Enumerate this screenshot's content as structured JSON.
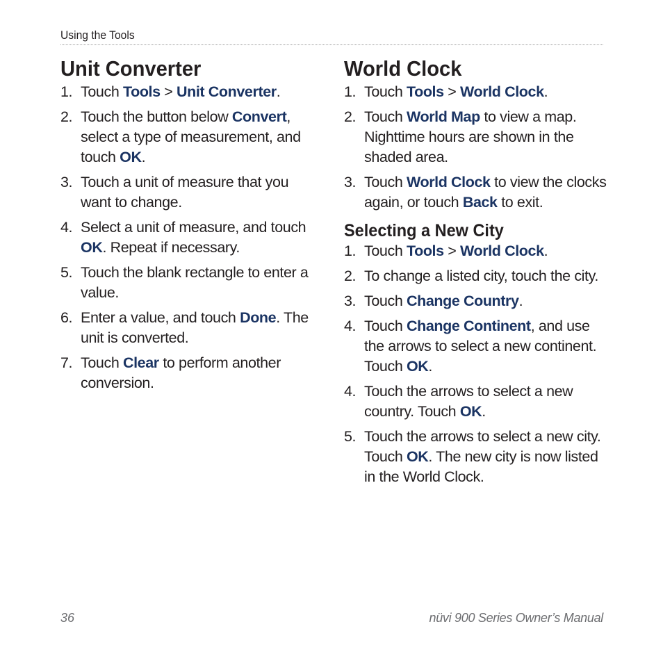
{
  "header": {
    "running_head": "Using the Tools"
  },
  "left": {
    "title": "Unit Converter",
    "steps": [
      {
        "num": "1.",
        "parts": [
          {
            "t": "Touch "
          },
          {
            "t": "Tools",
            "b": true
          },
          {
            "t": " > "
          },
          {
            "t": "Unit Converter",
            "b": true
          },
          {
            "t": "."
          }
        ]
      },
      {
        "num": "2.",
        "parts": [
          {
            "t": "Touch the button below "
          },
          {
            "t": "Convert",
            "b": true
          },
          {
            "t": ", select a type of measurement, and touch "
          },
          {
            "t": "OK",
            "b": true
          },
          {
            "t": "."
          }
        ]
      },
      {
        "num": "3.",
        "parts": [
          {
            "t": "Touch a unit of measure that you want to change."
          }
        ]
      },
      {
        "num": "4.",
        "parts": [
          {
            "t": "Select a unit of measure, and touch "
          },
          {
            "t": "OK",
            "b": true
          },
          {
            "t": ". Repeat if necessary."
          }
        ]
      },
      {
        "num": "5.",
        "parts": [
          {
            "t": "Touch the blank rectangle to enter a value."
          }
        ]
      },
      {
        "num": "6.",
        "parts": [
          {
            "t": "Enter a value, and touch "
          },
          {
            "t": "Done",
            "b": true
          },
          {
            "t": ". The unit is converted."
          }
        ]
      },
      {
        "num": "7.",
        "parts": [
          {
            "t": "Touch "
          },
          {
            "t": "Clear",
            "b": true
          },
          {
            "t": " to perform another conversion."
          }
        ]
      }
    ]
  },
  "right": {
    "title": "World Clock",
    "steps": [
      {
        "num": "1.",
        "parts": [
          {
            "t": "Touch "
          },
          {
            "t": "Tools",
            "b": true
          },
          {
            "t": " > "
          },
          {
            "t": "World Clock",
            "b": true
          },
          {
            "t": "."
          }
        ]
      },
      {
        "num": "2.",
        "parts": [
          {
            "t": "Touch "
          },
          {
            "t": "World Map",
            "b": true
          },
          {
            "t": " to view a map. Nighttime hours are shown in the shaded area."
          }
        ]
      },
      {
        "num": "3.",
        "parts": [
          {
            "t": "Touch "
          },
          {
            "t": "World Clock",
            "b": true
          },
          {
            "t": " to view the clocks again, or touch "
          },
          {
            "t": "Back",
            "b": true
          },
          {
            "t": " to exit."
          }
        ]
      }
    ],
    "subsection": {
      "title": "Selecting a New City",
      "steps": [
        {
          "num": "1.",
          "parts": [
            {
              "t": "Touch "
            },
            {
              "t": "Tools",
              "b": true
            },
            {
              "t": " > "
            },
            {
              "t": "World Clock",
              "b": true
            },
            {
              "t": "."
            }
          ]
        },
        {
          "num": "2.",
          "parts": [
            {
              "t": "To change a listed city, touch the city."
            }
          ]
        },
        {
          "num": "3.",
          "parts": [
            {
              "t": "Touch "
            },
            {
              "t": "Change Country",
              "b": true
            },
            {
              "t": "."
            }
          ]
        },
        {
          "num": "4.",
          "parts": [
            {
              "t": "Touch "
            },
            {
              "t": "Change Continent",
              "b": true
            },
            {
              "t": ", and use the arrows to select a new continent. Touch "
            },
            {
              "t": "OK",
              "b": true
            },
            {
              "t": "."
            }
          ]
        },
        {
          "num": "4.",
          "parts": [
            {
              "t": "Touch the arrows to select a new country. Touch "
            },
            {
              "t": "OK",
              "b": true
            },
            {
              "t": "."
            }
          ]
        },
        {
          "num": "5.",
          "parts": [
            {
              "t": "Touch the arrows to select a new city. Touch "
            },
            {
              "t": "OK",
              "b": true
            },
            {
              "t": ". The new city is now listed in the World Clock."
            }
          ]
        }
      ]
    }
  },
  "footer": {
    "page_number": "36",
    "manual_title": "nüvi 900 Series Owner’s Manual"
  },
  "colors": {
    "emphasis": "#1b3463",
    "body_text": "#231f20",
    "footer_text": "#6d6e71"
  }
}
